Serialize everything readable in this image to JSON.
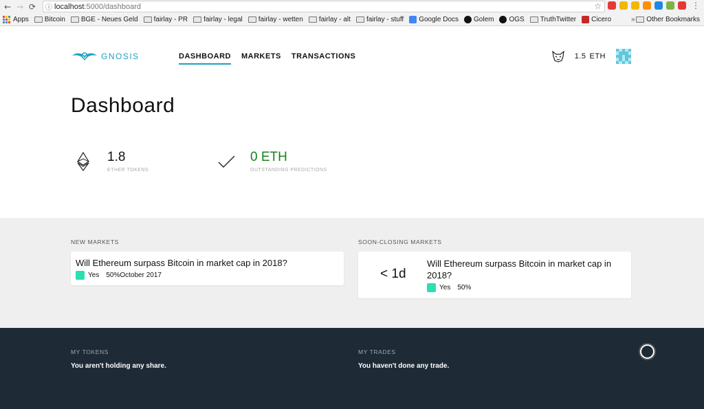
{
  "browser": {
    "url_host": "localhost",
    "url_path": ":5000/dashboard",
    "bookmarks": [
      {
        "label": "Apps",
        "icon": "apps-grid"
      },
      {
        "label": "Bitcoin",
        "icon": "folder"
      },
      {
        "label": "BGE - Neues Geld",
        "icon": "folder"
      },
      {
        "label": "fairlay - PR",
        "icon": "folder"
      },
      {
        "label": "fairlay - legal",
        "icon": "folder"
      },
      {
        "label": "fairlay - wetten",
        "icon": "folder"
      },
      {
        "label": "fairlay - alt",
        "icon": "folder"
      },
      {
        "label": "fairlay - stuff",
        "icon": "folder"
      },
      {
        "label": "Google Docs",
        "icon": "google-docs"
      },
      {
        "label": "Golem",
        "icon": "golem"
      },
      {
        "label": "OGS",
        "icon": "ogs"
      },
      {
        "label": "TruthTwitter",
        "icon": "folder"
      },
      {
        "label": "Cicero",
        "icon": "cicero"
      }
    ],
    "other_bookmarks": "Other Bookmarks",
    "extensions": [
      "#e53935",
      "#f2b705",
      "#f2b705",
      "#ff8f00",
      "#1e88e5",
      "#7cb342",
      "#e53935"
    ]
  },
  "header": {
    "logo_text": "GNOSIS",
    "nav": [
      {
        "label": "DASHBOARD",
        "active": true
      },
      {
        "label": "MARKETS",
        "active": false
      },
      {
        "label": "TRANSACTIONS",
        "active": false
      }
    ],
    "balance_amount": "1.5",
    "balance_unit": "ETH"
  },
  "page": {
    "title": "Dashboard"
  },
  "metrics": {
    "ether_tokens": {
      "value": "1.8",
      "label": "ETHER TOKENS"
    },
    "outstanding": {
      "value": "0 ETH",
      "label": "OUTSTANDING PREDICTIONS"
    }
  },
  "new_markets": {
    "title": "NEW MARKETS",
    "items": [
      {
        "question": "Will Ethereum surpass Bitcoin in market cap in 2018?",
        "outcome": "Yes",
        "percent": "50%",
        "date": "October 2017"
      }
    ]
  },
  "soon_closing": {
    "title": "SOON-CLOSING MARKETS",
    "items": [
      {
        "time_left": "< 1d",
        "question": "Will Ethereum surpass Bitcoin in market cap in 2018?",
        "outcome": "Yes",
        "percent": "50%"
      }
    ]
  },
  "my_tokens": {
    "title": "MY TOKENS",
    "text": "You aren't holding any share."
  },
  "my_trades": {
    "title": "MY TRADES",
    "text": "You haven't done any trade."
  },
  "colors": {
    "accent": "#1c9fc4",
    "positive": "#1a7f1a",
    "outcome_yes": "#2ae0b0",
    "dark_bg": "#1e2b36"
  }
}
